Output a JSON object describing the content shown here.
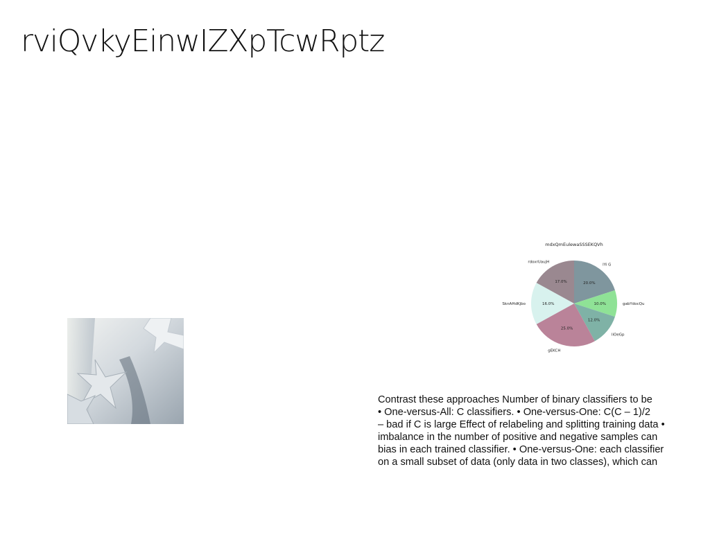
{
  "slide": {
    "title": "rviQvkyEinwIZXpTcwRptz",
    "body_lines": [
      "Contrast these approaches Number of binary classifiers to be",
      "• One-versus-All: C classifiers. • One-versus-One: C(C – 1)/2",
      "– bad if C is large Effect of relabeling and splitting training data •",
      "imbalance in the number of positive and negative samples can",
      "bias in each trained classifier. • One-versus-One: each classifier",
      "on a small subset of data (only data in two classes), which can"
    ]
  },
  "photo": {
    "subject": "white paper star ornaments on pale background",
    "colors": {
      "background": "#c9d0d6",
      "highlight": "#eef1f3",
      "shadow": "#7a8591"
    }
  },
  "chart_data": {
    "type": "pie",
    "title": "mdxQmEulewaSSSEKQVh",
    "slices": [
      {
        "label": "lYi G",
        "value": 20.0,
        "pct_label": "20.0%",
        "color": "#7f969e"
      },
      {
        "label": "gabYdocQu",
        "value": 10.0,
        "pct_label": "10.0%",
        "color": "#8fe296"
      },
      {
        "label": "liOeGp",
        "value": 12.0,
        "pct_label": "12.0%",
        "color": "#7fb2a6"
      },
      {
        "label": "gEKCH",
        "value": 25.0,
        "pct_label": "25.0%",
        "color": "#ba8399"
      },
      {
        "label": "SknAHdKjbo",
        "value": 16.0,
        "pct_label": "16.0%",
        "color": "#d8f2ee"
      },
      {
        "label": "rdoxrUaujH",
        "value": 17.0,
        "pct_label": "17.0%",
        "color": "#9a8890"
      }
    ],
    "start_angle": "12 o'clock",
    "direction": "clockwise",
    "legend": "none"
  }
}
